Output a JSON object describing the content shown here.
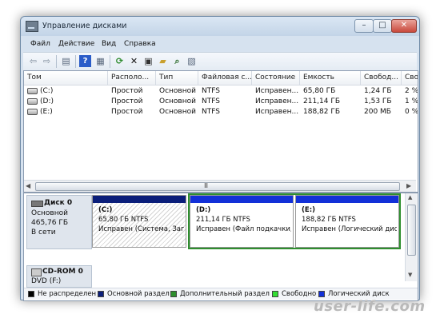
{
  "window": {
    "title": "Управление дисками"
  },
  "menu": [
    {
      "label": "Файл"
    },
    {
      "label": "Действие"
    },
    {
      "label": "Вид"
    },
    {
      "label": "Справка"
    }
  ],
  "toolbar": {
    "buttons": [
      {
        "icon": "back-arrow-icon",
        "glyph": "⇦"
      },
      {
        "icon": "forward-arrow-icon",
        "glyph": "⇨"
      },
      {
        "icon": "console-tree-icon",
        "glyph": "▤"
      },
      {
        "icon": "help-icon",
        "glyph": "?"
      },
      {
        "icon": "properties-pane-icon",
        "glyph": "▦"
      },
      {
        "icon": "refresh-icon",
        "glyph": "⟳"
      },
      {
        "icon": "delete-icon",
        "glyph": "✕"
      },
      {
        "icon": "properties-icon",
        "glyph": "▣"
      },
      {
        "icon": "open-folder-icon",
        "glyph": "▰"
      },
      {
        "icon": "search-icon",
        "glyph": "⌕"
      },
      {
        "icon": "view-icon",
        "glyph": "▧"
      }
    ]
  },
  "volumes": {
    "columns": [
      "Том",
      "Располо...",
      "Тип",
      "Файловая с...",
      "Состояние",
      "Емкость",
      "Свобод...",
      "Сво"
    ],
    "rows": [
      [
        "(C:)",
        "Простой",
        "Основной",
        "NTFS",
        "Исправен...",
        "65,80 ГБ",
        "1,24 ГБ",
        "2 %"
      ],
      [
        "(D:)",
        "Простой",
        "Основной",
        "NTFS",
        "Исправен...",
        "211,14 ГБ",
        "1,53 ГБ",
        "1 %"
      ],
      [
        "(E:)",
        "Простой",
        "Основной",
        "NTFS",
        "Исправен...",
        "188,82 ГБ",
        "200 МБ",
        "0 %"
      ]
    ],
    "scroll_grip": "III"
  },
  "disk0": {
    "name": "Диск 0",
    "type": "Основной",
    "size": "465,76 ГБ",
    "status": "В сети",
    "partitions": [
      {
        "letter": "(C:)",
        "size": "65,80 ГБ NTFS",
        "status": "Исправен (Система, Загр"
      },
      {
        "letter": "(D:)",
        "size": "211,14 ГБ NTFS",
        "status": "Исправен (Файл подкачки,"
      },
      {
        "letter": "(E:)",
        "size": "188,82 ГБ NTFS",
        "status": "Исправен (Логический дис"
      }
    ]
  },
  "cdrom": {
    "name": "CD-ROM 0",
    "type": "DVD (F:)"
  },
  "legend": [
    {
      "label": "Не распределен",
      "color": "#000000"
    },
    {
      "label": "Основной раздел",
      "color": "#0a1e7a"
    },
    {
      "label": "Дополнительный раздел",
      "color": "#2e8f2e"
    },
    {
      "label": "Свободно",
      "color": "#33dd33"
    },
    {
      "label": "Логический диск",
      "color": "#1230d8"
    }
  ],
  "watermark": "user-life.com"
}
